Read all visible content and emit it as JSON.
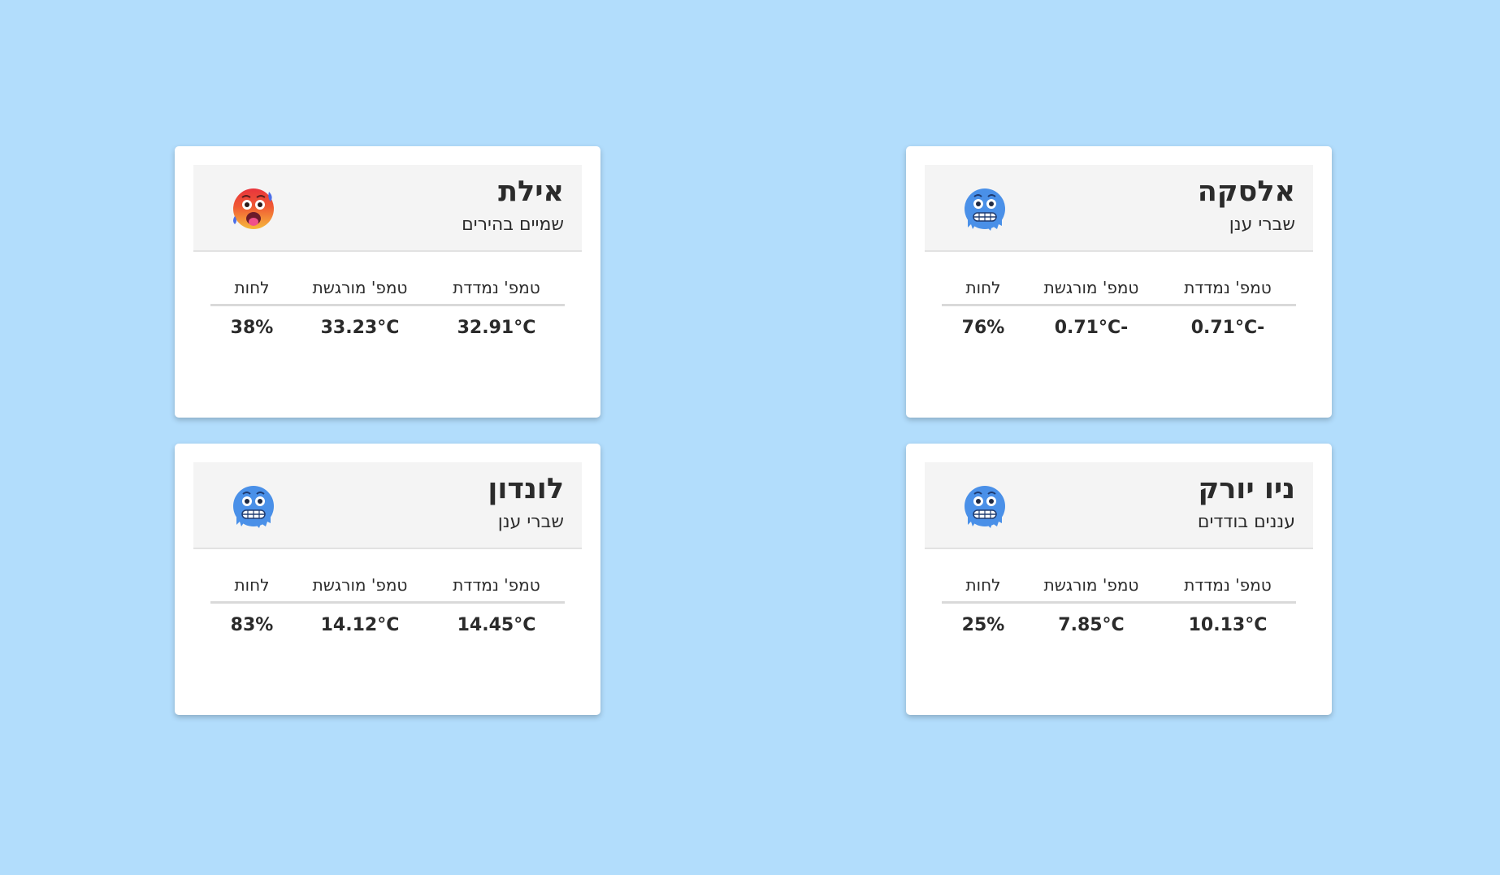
{
  "labels": {
    "measured": "טמפ' נמדדת",
    "feels": "טמפ' מורגשת",
    "humidity": "לחות"
  },
  "cards": [
    {
      "city": "אלסקה",
      "description": "שברי ענן",
      "icon": "cold-face-icon",
      "measured": "-0.71°C",
      "feels": "-0.71°C",
      "humidity": "76%"
    },
    {
      "city": "אילת",
      "description": "שמיים בהירים",
      "icon": "hot-face-icon",
      "measured": "32.91°C",
      "feels": "33.23°C",
      "humidity": "38%"
    },
    {
      "city": "ניו יורק",
      "description": "עננים בודדים",
      "icon": "cold-face-icon",
      "measured": "10.13°C",
      "feels": "7.85°C",
      "humidity": "25%"
    },
    {
      "city": "לונדון",
      "description": "שברי ענן",
      "icon": "cold-face-icon",
      "measured": "14.45°C",
      "feels": "14.12°C",
      "humidity": "83%"
    }
  ],
  "colors": {
    "background": "#b2ddfc",
    "card": "#ffffff",
    "header": "#f4f4f4",
    "cold_face": "#4a90e8",
    "hot_face": "#f5b73a"
  }
}
